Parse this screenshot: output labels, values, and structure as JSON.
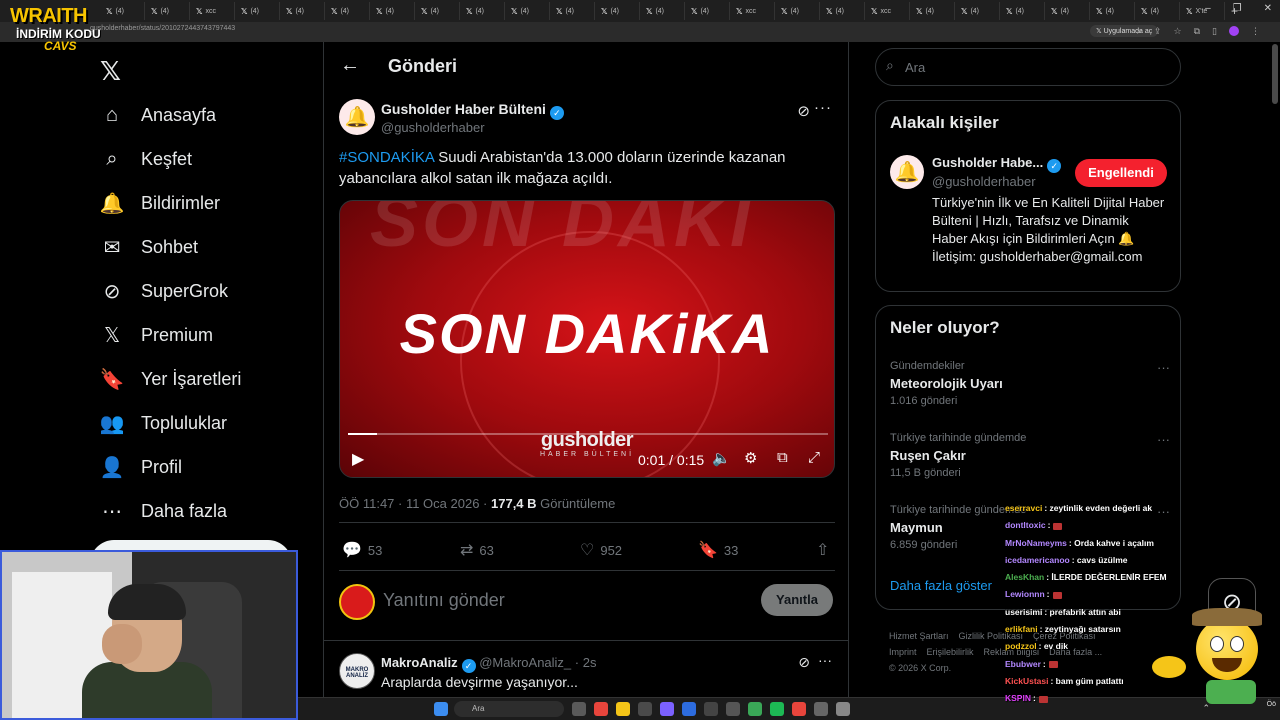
{
  "browser": {
    "tab_labels": [
      "(4)",
      "(4)",
      "xcc",
      "(4)",
      "(4)",
      "(4)",
      "(4)",
      "(4)",
      "(4)",
      "(4)",
      "(4)",
      "(4)",
      "(4)",
      "(4)",
      "xcc",
      "(4)",
      "(4)",
      "xcc",
      "(4)",
      "(4)",
      "(4)",
      "(4)",
      "(4)",
      "(4)",
      "X'te"
    ],
    "url": "gusholderhaber/status/2010272443743797443",
    "open_in_app": "Uygulamada aç"
  },
  "overlay": {
    "logo_line1": "WRAITH",
    "logo_line2": "İNDİRİM KODU",
    "logo_line3": "CAVS"
  },
  "nav": {
    "items": [
      {
        "label": "Anasayfa",
        "icon": "home-icon"
      },
      {
        "label": "Keşfet",
        "icon": "search-icon"
      },
      {
        "label": "Bildirimler",
        "icon": "bell-icon"
      },
      {
        "label": "Sohbet",
        "icon": "mail-icon"
      },
      {
        "label": "SuperGrok",
        "icon": "grok-icon"
      },
      {
        "label": "Premium",
        "icon": "x-icon"
      },
      {
        "label": "Yer İşaretleri",
        "icon": "bookmark-icon"
      },
      {
        "label": "Topluluklar",
        "icon": "communities-icon"
      },
      {
        "label": "Profil",
        "icon": "profile-icon"
      },
      {
        "label": "Daha fazla",
        "icon": "more-circle-icon"
      }
    ]
  },
  "post": {
    "header_title": "Gönderi",
    "author_name": "Gusholder Haber Bülteni",
    "author_handle": "@gusholderhaber",
    "hashtag": "#SONDAKİKA",
    "text": " Suudi Arabistan'da 13.000 doların üzerinde kazanan yabancılara alkol satan ilk mağaza açıldı.",
    "video": {
      "ghost_text": "SON DAKİ",
      "headline": "SON DAKiKA",
      "brand": "gusholder",
      "brand_sub": "HABER BÜLTENİ",
      "time": "0:01 / 0:15",
      "progress": 0.06
    },
    "meta_time": "ÖÖ 11:47 · 11 Oca 2026 · ",
    "views_count": "177,4 B",
    "views_label": " Görüntüleme",
    "stats": {
      "replies": "53",
      "reposts": "63",
      "likes": "952",
      "bookmarks": "33"
    },
    "reply_placeholder": "Yanıtını gönder",
    "reply_button": "Yanıtla"
  },
  "reply": {
    "author_name": "MakroAnaliz",
    "author_handle": "@MakroAnaliz_ · 2s",
    "avatar_text": "MAKRO ANALİZ",
    "text": "Araplarda devşirme yaşanıyor..."
  },
  "right": {
    "search_placeholder": "Ara",
    "related_title": "Alakalı kişiler",
    "related_name": "Gusholder Habe...",
    "related_handle": "@gusholderhaber",
    "related_button": "Engellendi",
    "related_bio": "Türkiye'nin İlk ve En Kaliteli Dijital Haber Bülteni | Hızlı, Tarafsız ve Dinamik Haber Akışı için Bildirimleri Açın 🔔 İletişim: gusholderhaber@gmail.com",
    "trends_title": "Neler oluyor?",
    "trends": [
      {
        "context": "Gündemdekiler",
        "name": "Meteorolojik Uyarı",
        "count": "1.016 gönderi"
      },
      {
        "context": "Türkiye tarihinde gündemde",
        "name": "Ruşen Çakır",
        "count": "11,5 B gönderi"
      },
      {
        "context": "Türkiye tarihinde gündemde",
        "name": "Maymun",
        "count": "6.859 gönderi"
      }
    ],
    "show_more": "Daha fazla göster",
    "footer": [
      "Hizmet Şartları",
      "Gizlilik Politikası",
      "Çerez Politikası",
      "Imprint",
      "Erişilebilirlik",
      "Reklam bilgisi",
      "Daha fazla ...",
      "© 2026 X Corp."
    ]
  },
  "chat": [
    {
      "user": "eserravci",
      "color": "#f5c518",
      "text": ": zeytinlik evden değerli ak",
      "emote": false
    },
    {
      "user": "dontltoxic",
      "color": "#b388ff",
      "text": ":",
      "emote": true
    },
    {
      "user": "MrNoNameyms",
      "color": "#b388ff",
      "text": ": Orda kahve i açalım",
      "emote": false
    },
    {
      "user": "icedamericanoo",
      "color": "#b388ff",
      "text": ": cavs üzülme",
      "emote": false
    },
    {
      "user": "AlesKhan",
      "color": "#4caf50",
      "text": ": İLERDE DEĞERLENİR EFEM",
      "emote": false
    },
    {
      "user": "Lewionnn",
      "color": "#b388ff",
      "text": ":",
      "emote": true
    },
    {
      "user": "userisimi",
      "color": "#ffffff",
      "text": ": prefabrik attın abi",
      "emote": false
    },
    {
      "user": "erlikfani",
      "color": "#f5c518",
      "text": ": zeytinyağı satarsın",
      "emote": false
    },
    {
      "user": "podzzol",
      "color": "#f5c518",
      "text": ": ev dik",
      "emote": false
    },
    {
      "user": "Ebubwer",
      "color": "#b388ff",
      "text": ":",
      "emote": true
    },
    {
      "user": "KickUstasi",
      "color": "#ff5252",
      "text": ": bam güm patlattı",
      "emote": false
    },
    {
      "user": "KSPIN",
      "color": "#e040fb",
      "text": ":",
      "emote": true
    }
  ],
  "taskbar": {
    "search_placeholder": "Ara",
    "clock": "Öö"
  },
  "colors": {
    "accent": "#1d9bf0",
    "blocked": "#f4212e",
    "background": "#000000",
    "border": "#2f3336"
  }
}
